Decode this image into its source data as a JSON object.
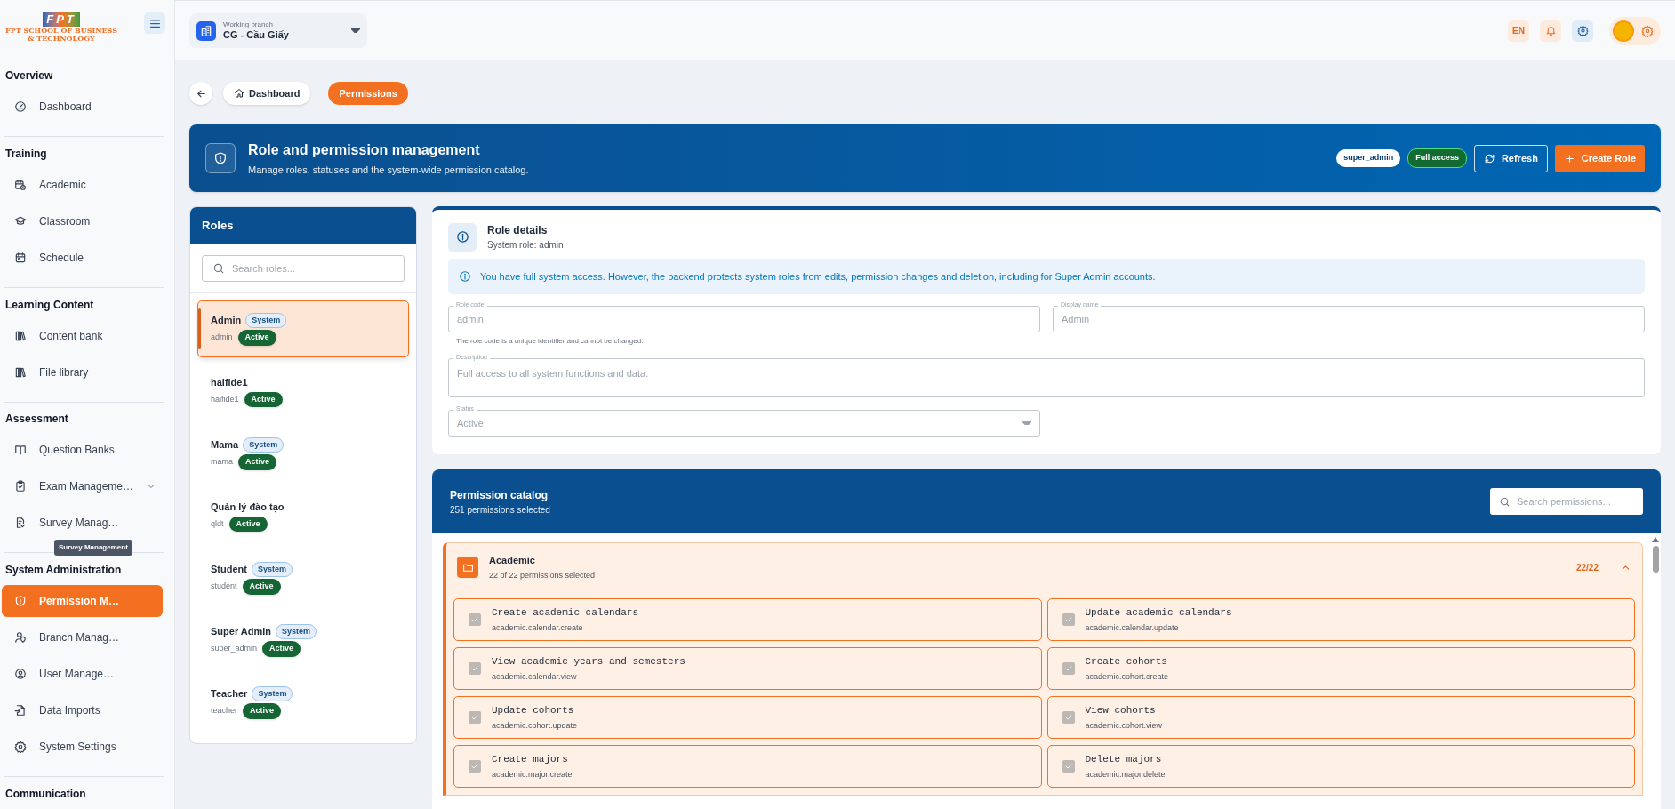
{
  "sidebar": {
    "logo": {
      "mark": "FPT",
      "lines": [
        "FPT SCHOOL OF BUSINESS",
        "& TECHNOLOGY"
      ]
    },
    "sections": [
      {
        "title": "Overview",
        "items": [
          {
            "label": "Dashboard",
            "selected": false
          }
        ]
      },
      {
        "title": "Training",
        "items": [
          {
            "label": "Academic",
            "selected": false
          },
          {
            "label": "Classroom",
            "selected": false
          },
          {
            "label": "Schedule",
            "selected": false
          }
        ]
      },
      {
        "title": "Learning Content",
        "items": [
          {
            "label": "Content bank",
            "selected": false
          },
          {
            "label": "File library",
            "selected": false
          }
        ]
      },
      {
        "title": "Assessment",
        "items": [
          {
            "label": "Question Banks",
            "selected": false,
            "expandable": false
          },
          {
            "label": "Exam Manageme…",
            "selected": false,
            "expandable": true
          },
          {
            "label": "Survey Manag…",
            "selected": false,
            "tooltip": "Survey Management"
          }
        ]
      },
      {
        "title": "System Administration",
        "items": [
          {
            "label": "Permission M…",
            "selected": true
          },
          {
            "label": "Branch Manag…",
            "selected": false
          },
          {
            "label": "User Manage…",
            "selected": false
          },
          {
            "label": "Data Imports",
            "selected": false
          },
          {
            "label": "System Settings",
            "selected": false
          }
        ]
      },
      {
        "title": "Communication"
      }
    ]
  },
  "header": {
    "branch": {
      "label": "Working branch",
      "value": "CG - Cầu Giấy"
    },
    "language": "EN"
  },
  "breadcrumb": [
    {
      "label": "Dashboard",
      "selected": false
    },
    {
      "label": "Permissions",
      "selected": true
    }
  ],
  "banner": {
    "title": "Role and permission management",
    "subtitle": "Manage roles, statuses and the system-wide permission catalog.",
    "badges": [
      {
        "text": "super_admin",
        "kind": "role"
      },
      {
        "text": "Full access",
        "kind": "access"
      }
    ],
    "buttons": [
      {
        "label": "Refresh",
        "kind": "outline"
      },
      {
        "label": "Create Role",
        "kind": "primary"
      }
    ]
  },
  "roles": {
    "title": "Roles",
    "search": {
      "placeholder": "Search roles..."
    },
    "items": [
      {
        "name": "Admin",
        "code": "admin",
        "badge": "System",
        "status": "Active",
        "selected": true
      },
      {
        "name": "haifide1",
        "code": "haifide1",
        "status": "Active",
        "selected": false
      },
      {
        "name": "Mama",
        "code": "mama",
        "badge": "System",
        "status": "Active",
        "selected": false
      },
      {
        "name": "Quản lý đào tạo",
        "code": "qldt",
        "status": "Active",
        "selected": false
      },
      {
        "name": "Student",
        "code": "student",
        "badge": "System",
        "status": "Active",
        "selected": false
      },
      {
        "name": "Super Admin",
        "code": "super_admin",
        "badge": "System",
        "status": "Active",
        "selected": false
      },
      {
        "name": "Teacher",
        "code": "teacher",
        "badge": "System",
        "status": "Active",
        "selected": false
      }
    ]
  },
  "role_details": {
    "title": "Role details",
    "subtitle": "System role: admin",
    "notice": "You have full system access. However, the backend protects system roles from edits, permission changes and deletion, including for Super Admin accounts.",
    "fields": [
      {
        "kind": "text",
        "label": "Role code",
        "value": "admin",
        "disabled": true,
        "helper": "The role code is a unique identifier and cannot be changed."
      },
      {
        "kind": "text",
        "label": "Display name",
        "value": "Admin",
        "disabled": true
      },
      {
        "kind": "textarea",
        "label": "Description",
        "value": "Full access to all system functions and data.",
        "disabled": true
      },
      {
        "kind": "select",
        "label": "Status",
        "value": "Active",
        "disabled": true
      }
    ]
  },
  "catalog": {
    "title": "Permission catalog",
    "summary": "251 permissions selected",
    "search": {
      "placeholder": "Search permissions..."
    },
    "groups": [
      {
        "name": "Academic",
        "summary": "22 of 22 permissions selected",
        "count": "22/22",
        "expanded": true,
        "permissions": [
          {
            "title": "Create academic calendars",
            "code": "academic.calendar.create",
            "checked": true
          },
          {
            "title": "Update academic calendars",
            "code": "academic.calendar.update",
            "checked": true
          },
          {
            "title": "View academic years and semesters",
            "code": "academic.calendar.view",
            "checked": true
          },
          {
            "title": "Create cohorts",
            "code": "academic.cohort.create",
            "checked": true
          },
          {
            "title": "Update cohorts",
            "code": "academic.cohort.update",
            "checked": true
          },
          {
            "title": "View cohorts",
            "code": "academic.cohort.view",
            "checked": true
          },
          {
            "title": "Create majors",
            "code": "academic.major.create",
            "checked": true
          },
          {
            "title": "Delete majors",
            "code": "academic.major.delete",
            "checked": true
          }
        ]
      }
    ]
  }
}
